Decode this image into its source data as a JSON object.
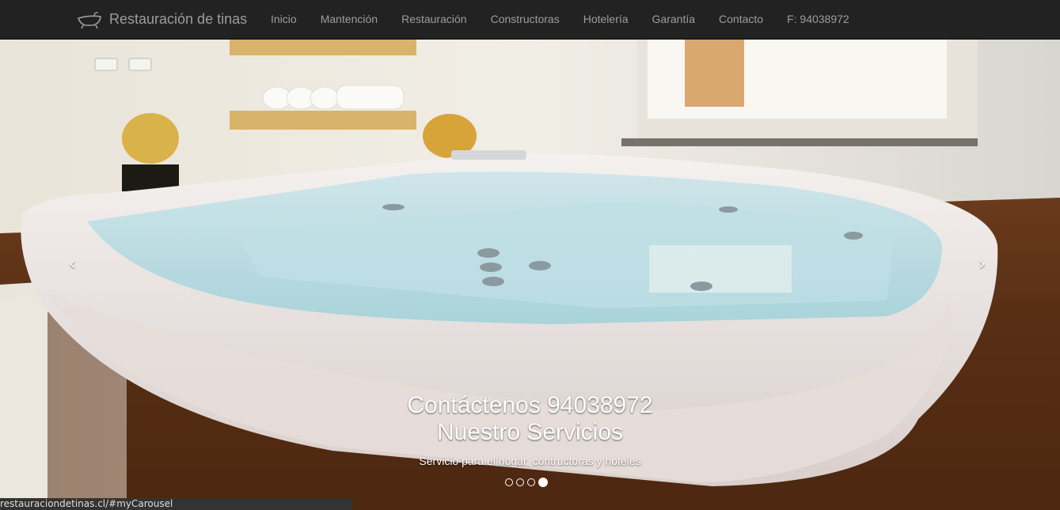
{
  "navbar": {
    "brand": "Restauración de tinas",
    "brand_icon": "bathtub-icon",
    "items": [
      {
        "label": "Inicio"
      },
      {
        "label": "Mantención"
      },
      {
        "label": "Restauración"
      },
      {
        "label": "Constructoras"
      },
      {
        "label": "Hotelería"
      },
      {
        "label": "Garantía"
      },
      {
        "label": "Contacto"
      },
      {
        "label": "F: 94038972"
      }
    ]
  },
  "carousel": {
    "caption_line1": "Contáctenos 94038972",
    "caption_line2": "Nuestro Servicios",
    "caption_text": "Servicio para el hogar, contructoras y hoteles",
    "prev": "‹",
    "next": "›",
    "indicator_count": 4,
    "active_indicator": 4
  },
  "status_bar": {
    "url": "restauraciondetinas.cl/#myCarousel"
  },
  "colors": {
    "navbar_bg": "#222222",
    "nav_text": "#9d9d9d",
    "caption_text": "#ffffff"
  }
}
